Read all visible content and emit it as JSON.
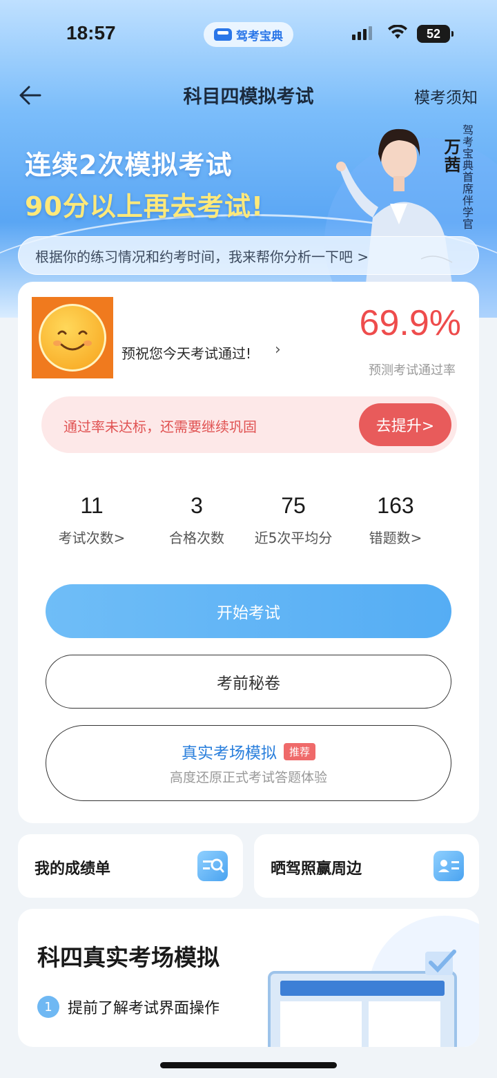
{
  "status_bar": {
    "time": "18:57",
    "app_name": "驾考宝典",
    "battery": "52"
  },
  "nav": {
    "title": "科目四模拟考试",
    "right_link": "模考须知"
  },
  "banner": {
    "line1": "连续2次模拟考试",
    "line2": "90分以上再去考试!",
    "host_name": "万茜",
    "host_title": "驾考宝典首席伴学官"
  },
  "analysis_prompt": "根据你的练习情况和约考时间，我来帮你分析一下吧 >",
  "user": {
    "greeting": "预祝您今天考试通过!"
  },
  "prediction": {
    "pass_rate": "69.9%",
    "pass_rate_label": "预测考试通过率"
  },
  "alert": {
    "text": "通过率未达标，还需要继续巩固",
    "button": "去提升>"
  },
  "stats": [
    {
      "value": "11",
      "label": "考试次数>"
    },
    {
      "value": "3",
      "label": "合格次数"
    },
    {
      "value": "75",
      "label": "近5次平均分"
    },
    {
      "value": "163",
      "label": "错题数>"
    }
  ],
  "buttons": {
    "start": "开始考试",
    "secret": "考前秘卷",
    "simulate_title": "真实考场模拟",
    "simulate_tag": "推荐",
    "simulate_sub": "高度还原正式考试答题体验"
  },
  "mini_cards": [
    {
      "label": "我的成绩单",
      "icon": "report-search-icon"
    },
    {
      "label": "晒驾照赢周边",
      "icon": "license-card-icon"
    }
  ],
  "bottom": {
    "title": "科四真实考场模拟",
    "steps": [
      {
        "num": "1",
        "text": "提前了解考试界面操作"
      }
    ]
  },
  "colors": {
    "accent_blue": "#55adf4",
    "alert_red": "#e85b5b",
    "rate_red": "#ee4c4c",
    "headline_yellow": "#ffe97a"
  }
}
